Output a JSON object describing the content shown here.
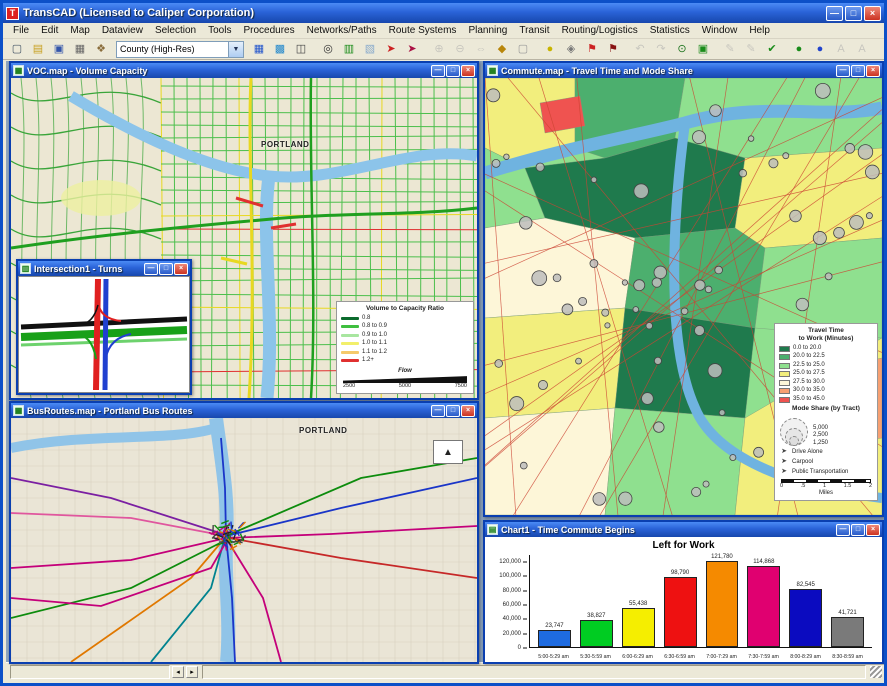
{
  "window": {
    "title": "TransCAD (Licensed to Caliper Corporation)",
    "controls": {
      "minimize": "—",
      "maximize": "□",
      "close": "×"
    }
  },
  "menu": {
    "items": [
      "File",
      "Edit",
      "Map",
      "Dataview",
      "Selection",
      "Tools",
      "Procedures",
      "Networks/Paths",
      "Route Systems",
      "Planning",
      "Transit",
      "Routing/Logistics",
      "Statistics",
      "Window",
      "Help"
    ]
  },
  "toolbar": {
    "scale_dropdown": "County (High-Res)",
    "icons": [
      {
        "name": "new-file-icon",
        "glyph": "▢",
        "color": "#445566",
        "enabled": true
      },
      {
        "name": "open-folder-icon",
        "glyph": "▤",
        "color": "#c8a020",
        "enabled": true
      },
      {
        "name": "save-icon",
        "glyph": "▣",
        "color": "#3355aa",
        "enabled": true
      },
      {
        "name": "print-icon",
        "glyph": "▦",
        "color": "#666666",
        "enabled": true
      },
      {
        "name": "pushpin-icon",
        "glyph": "❖",
        "color": "#8a6d3b",
        "enabled": true
      },
      {
        "name": "dataview-table-icon",
        "glyph": "▦",
        "color": "#2255cc",
        "enabled": true
      },
      {
        "name": "map-window-icon",
        "glyph": "▩",
        "color": "#2288cc",
        "enabled": true
      },
      {
        "name": "tile-windows-icon",
        "glyph": "◫",
        "color": "#444444",
        "enabled": true
      },
      {
        "name": "find-icon",
        "glyph": "◎",
        "color": "#333333",
        "enabled": true
      },
      {
        "name": "map-legend-icon",
        "glyph": "▥",
        "color": "#1a8c1a",
        "enabled": true
      },
      {
        "name": "layers-icon",
        "glyph": "▧",
        "color": "#88aacc",
        "enabled": true
      },
      {
        "name": "select-pointer-icon",
        "glyph": "➤",
        "color": "#cc2222",
        "enabled": true
      },
      {
        "name": "select-by-shape-icon",
        "glyph": "➤",
        "color": "#aa1144",
        "enabled": true
      },
      {
        "name": "zoom-in-icon",
        "glyph": "⊕",
        "color": "#555555",
        "enabled": false
      },
      {
        "name": "zoom-out-icon",
        "glyph": "⊖",
        "color": "#555555",
        "enabled": false
      },
      {
        "name": "pan-icon",
        "glyph": "⇔",
        "color": "#555555",
        "enabled": false
      },
      {
        "name": "fill-style-icon",
        "glyph": "◆",
        "color": "#b8860b",
        "enabled": true
      },
      {
        "name": "label-style-icon",
        "glyph": "▢",
        "color": "#999999",
        "enabled": true
      },
      {
        "name": "theme-icon",
        "glyph": "●",
        "color": "#c8b400",
        "enabled": true
      },
      {
        "name": "info-icon",
        "glyph": "◈",
        "color": "#777777",
        "enabled": true
      },
      {
        "name": "route-flag-start-icon",
        "glyph": "⚑",
        "color": "#cc2222",
        "enabled": true
      },
      {
        "name": "route-flag-end-icon",
        "glyph": "⚑",
        "color": "#881111",
        "enabled": true
      },
      {
        "name": "undo-icon",
        "glyph": "↶",
        "color": "#555555",
        "enabled": false
      },
      {
        "name": "redo-icon",
        "glyph": "↷",
        "color": "#555555",
        "enabled": false
      },
      {
        "name": "geo-tools-icon",
        "glyph": "⊙",
        "color": "#227722",
        "enabled": true
      },
      {
        "name": "network-icon",
        "glyph": "▣",
        "color": "#1a8c1a",
        "enabled": true
      },
      {
        "name": "edit-line-icon",
        "glyph": "✎",
        "color": "#555555",
        "enabled": false
      },
      {
        "name": "edit-node-icon",
        "glyph": "✎",
        "color": "#884400",
        "enabled": false
      },
      {
        "name": "confirm-edit-icon",
        "glyph": "✔",
        "color": "#1a8c1a",
        "enabled": true
      },
      {
        "name": "drive-alone-ball-icon",
        "glyph": "●",
        "color": "#1a8c1a",
        "enabled": true
      },
      {
        "name": "transit-ball-icon",
        "glyph": "●",
        "color": "#2244cc",
        "enabled": true
      },
      {
        "name": "label-a-icon",
        "glyph": "A",
        "color": "#555555",
        "enabled": false
      },
      {
        "name": "label-b-icon",
        "glyph": "A",
        "color": "#999999",
        "enabled": false
      }
    ]
  },
  "windows": {
    "voc": {
      "title": "VOC.map - Volume Capacity",
      "map_label": "PORTLAND",
      "legend": {
        "title": "Volume to Capacity Ratio",
        "entries": [
          {
            "label": "0.8",
            "color": "#0b6b2d"
          },
          {
            "label": "0.8 to 0.9",
            "color": "#3fbf3f"
          },
          {
            "label": "0.9 to 1.0",
            "color": "#a8e6a0"
          },
          {
            "label": "1.0 to 1.1",
            "color": "#f2ef6a"
          },
          {
            "label": "1.1 to 1.2",
            "color": "#f5c96a"
          },
          {
            "label": "1.2+",
            "color": "#e03030"
          }
        ],
        "flow_title": "Flow",
        "flow_ticks": [
          "2500",
          "5000",
          "7500"
        ]
      }
    },
    "commute": {
      "title": "Commute.map - Travel Time and Mode Share",
      "legend": {
        "title_line1": "Travel Time",
        "title_line2": "to Work (Minutes)",
        "entries": [
          {
            "label": "0.0 to 20.0",
            "color": "#1f7a4d"
          },
          {
            "label": "20.0 to 22.5",
            "color": "#4caf6e"
          },
          {
            "label": "22.5 to 25.0",
            "color": "#8fe08f"
          },
          {
            "label": "25.0 to 27.5",
            "color": "#f2ee7d"
          },
          {
            "label": "27.5 to 30.0",
            "color": "#fdf6d8"
          },
          {
            "label": "30.0 to 35.0",
            "color": "#f7a072"
          },
          {
            "label": "35.0 to 45.0",
            "color": "#ef5350"
          }
        ],
        "mode_title": "Mode Share (by Tract)",
        "mode_sizes": [
          "5,000",
          "2,500",
          "1,250"
        ],
        "mode_entries": [
          {
            "label": "Drive Alone",
            "glyph": "➤"
          },
          {
            "label": "Carpool",
            "glyph": "➤"
          },
          {
            "label": "Public Transportation",
            "glyph": "➤"
          }
        ],
        "scale_ticks": [
          "0",
          ".5",
          "1",
          "1.5",
          "2"
        ],
        "scale_unit": "Miles"
      }
    },
    "intersection": {
      "title": "Intersection1 - Turns"
    },
    "busroutes": {
      "title": "BusRoutes.map - Portland Bus Routes",
      "map_label": "PORTLAND"
    },
    "chart": {
      "title": "Chart1 - Time Commute Begins"
    }
  },
  "chart_data": {
    "type": "bar",
    "title": "Left for Work",
    "categories": [
      "5:00-5:29 am",
      "5:30-5:59 am",
      "6:00-6:29 am",
      "6:30-6:59 am",
      "7:00-7:29 am",
      "7:30-7:59 am",
      "8:00-8:29 am",
      "8:30-8:59 am"
    ],
    "values": [
      23747,
      38827,
      55438,
      98790,
      121780,
      114868,
      82545,
      41721
    ],
    "value_labels": [
      "23,747",
      "38,827",
      "55,438",
      "98,790",
      "121,780",
      "114,868",
      "82,545",
      "41,721"
    ],
    "bar_colors": [
      "#1e6be0",
      "#00cc22",
      "#f5ee00",
      "#ee1111",
      "#f58a00",
      "#e00070",
      "#0b0bc0",
      "#7a7a7a"
    ],
    "ylim": [
      0,
      130000
    ],
    "yticks": [
      "120,000",
      "100,000",
      "80,000",
      "60,000",
      "40,000",
      "20,000",
      "0"
    ],
    "xlabel": "",
    "ylabel": "",
    "legend_position": "none",
    "grid": false
  }
}
